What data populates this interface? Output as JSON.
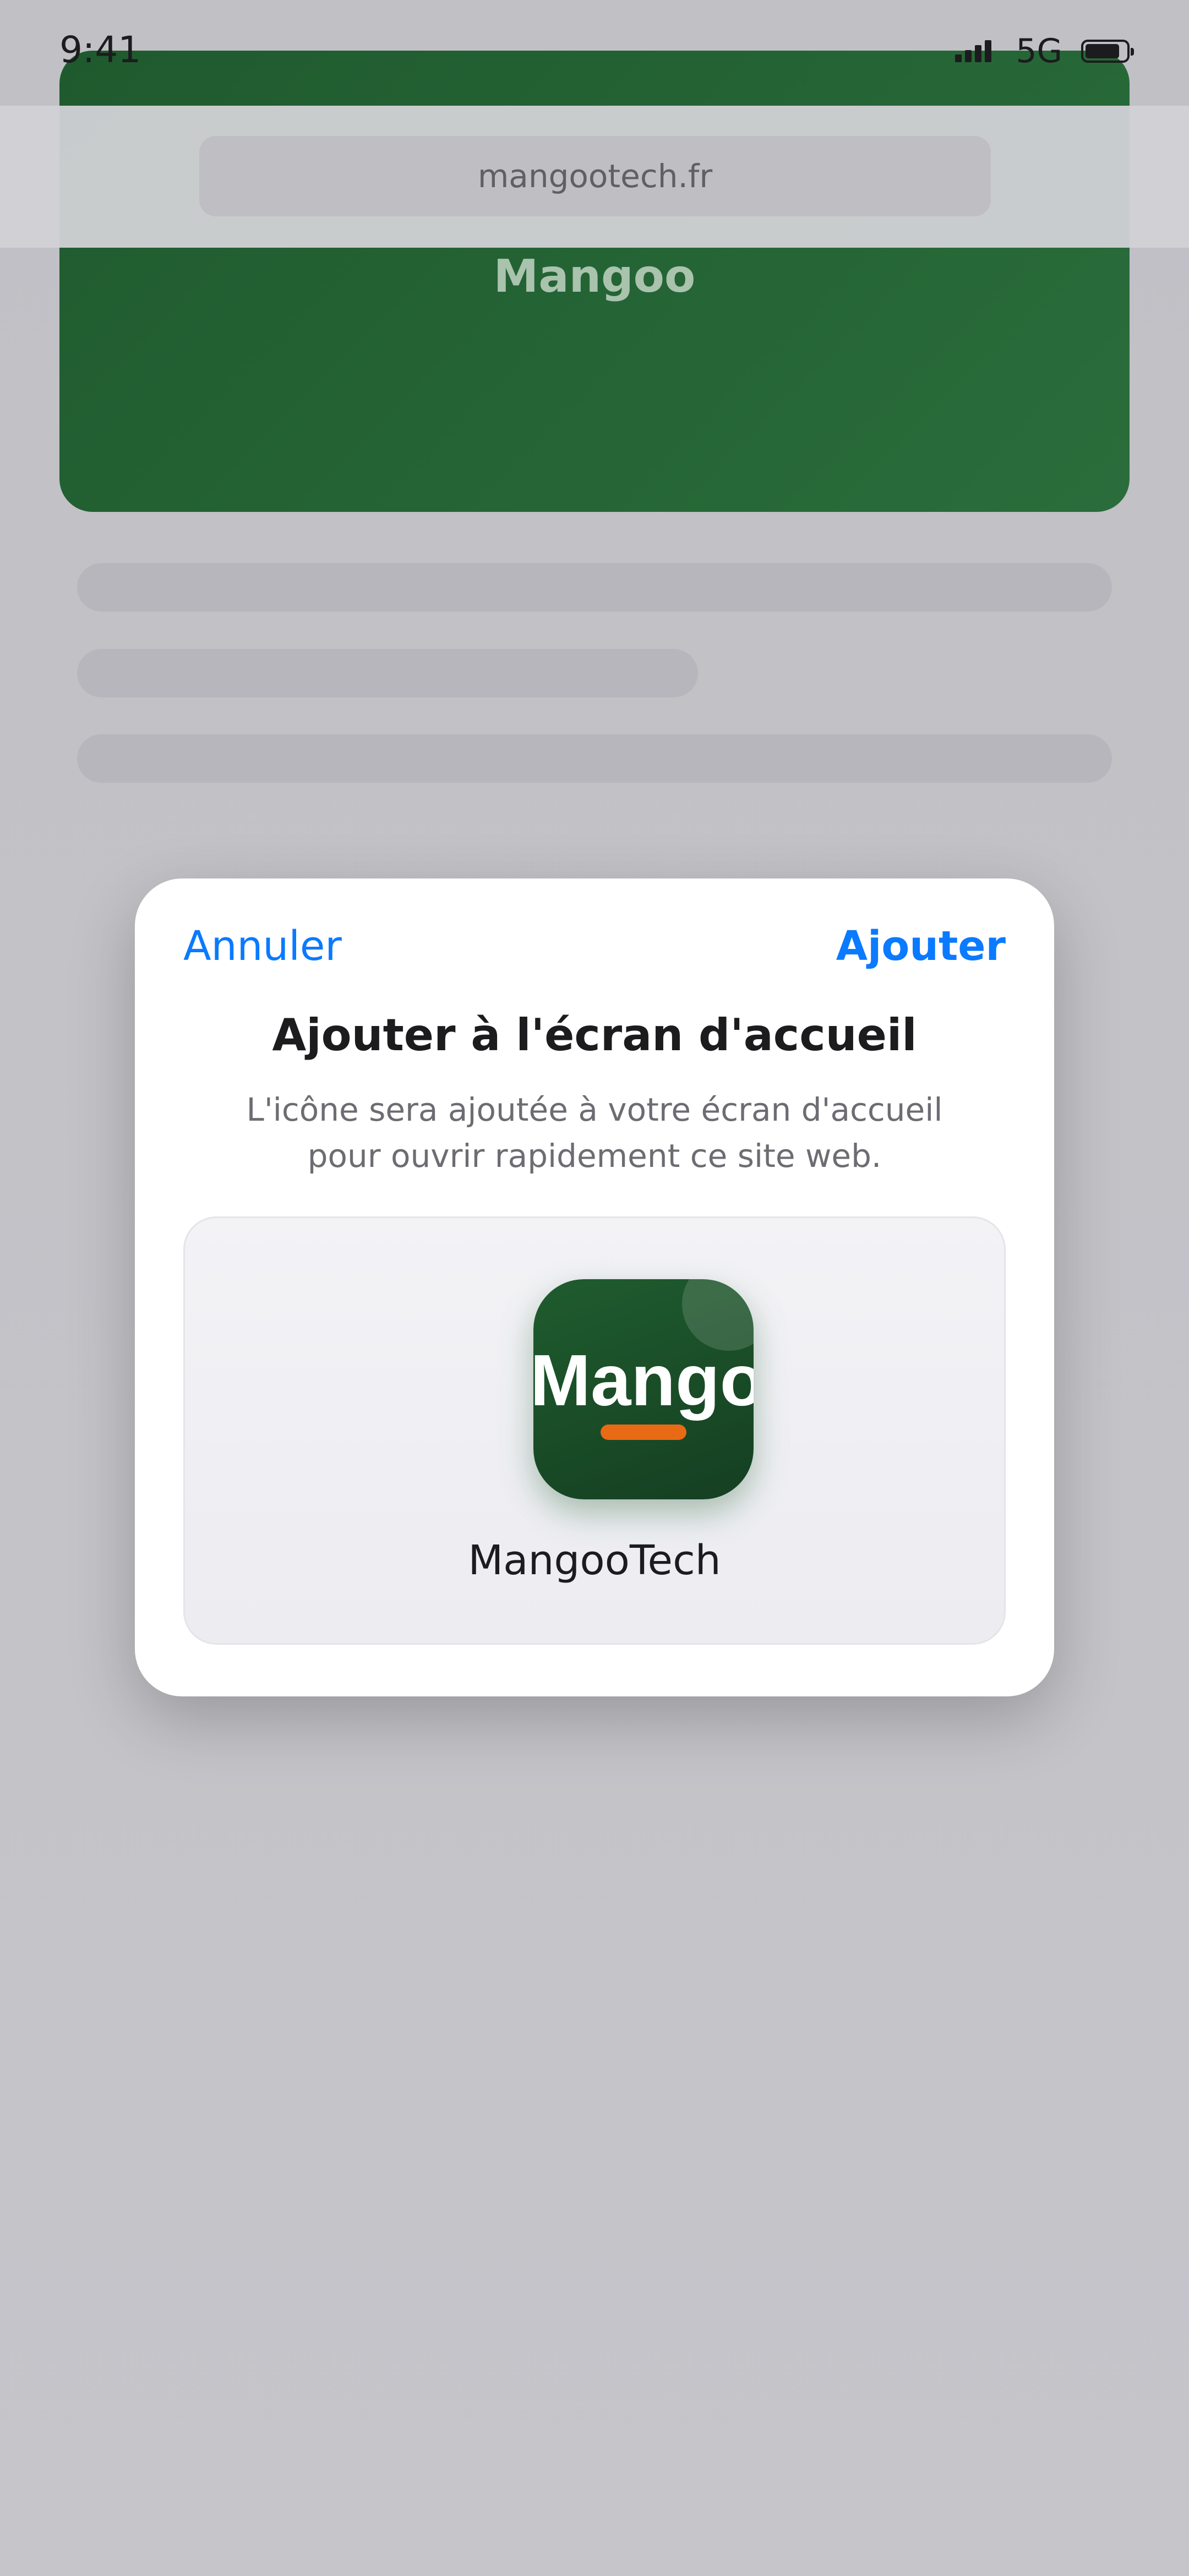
{
  "status_bar": {
    "time": "9:41",
    "network": "5G",
    "signal_bars": 4,
    "battery_level": 0.85
  },
  "browser": {
    "url": "mangootech.fr"
  },
  "page": {
    "hero_title": "Mangoo",
    "hero_color": "#245f34"
  },
  "dialog": {
    "cancel_label": "Annuler",
    "add_label": "Ajouter",
    "title": "Ajouter à l'écran d'accueil",
    "description": "L'icône sera ajoutée à votre écran d'accueil pour ouvrir rapidement ce site web.",
    "accent_color": "#0a7aff"
  },
  "app_preview": {
    "icon_text": "Mangoo",
    "icon_accent": "#e86a14",
    "app_name": "MangooTech"
  },
  "icons": {
    "signal": "cellular-signal-icon",
    "battery": "battery-icon"
  }
}
